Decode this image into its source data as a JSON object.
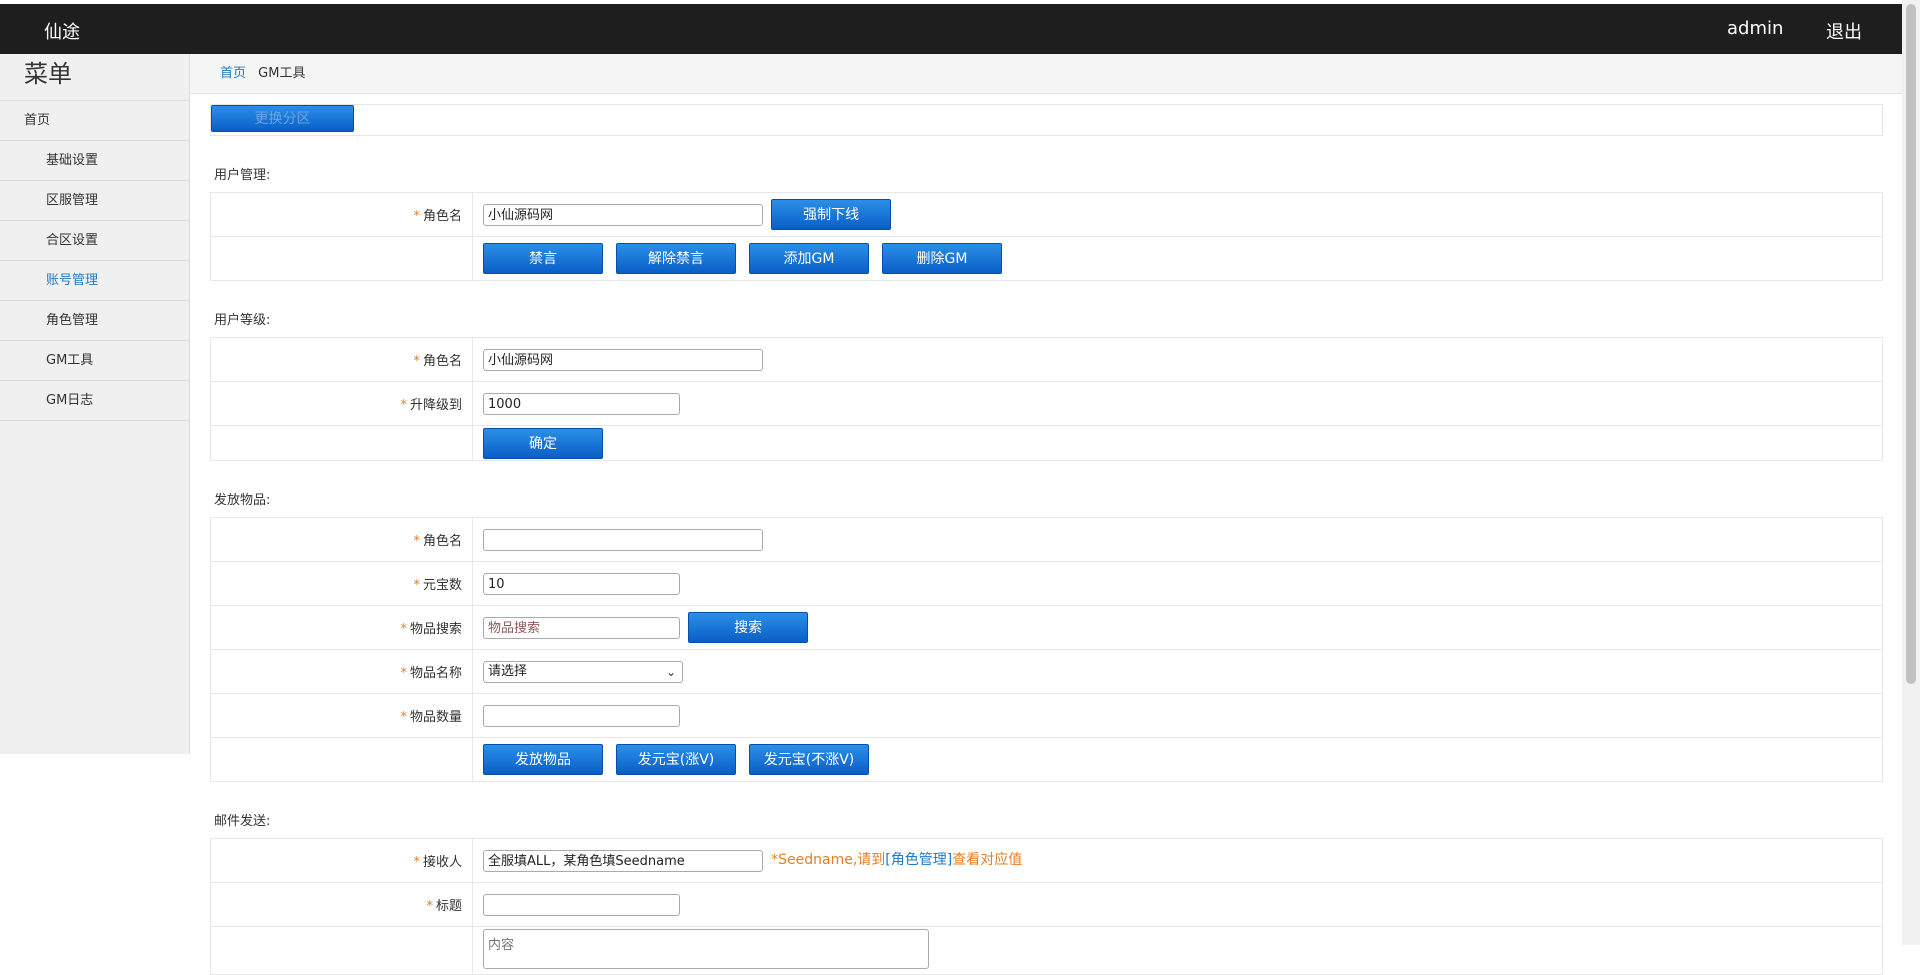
{
  "topbar": {
    "brand": "仙途",
    "user": "admin",
    "logout": "退出"
  },
  "sidebar": {
    "title": "菜单",
    "items": [
      {
        "label": "首页"
      },
      {
        "label": "基础设置"
      },
      {
        "label": "区服管理"
      },
      {
        "label": "合区设置"
      },
      {
        "label": "账号管理"
      },
      {
        "label": "角色管理"
      },
      {
        "label": "GM工具"
      },
      {
        "label": "GM日志"
      }
    ]
  },
  "breadcrumb": {
    "home": "首页",
    "current": "GM工具"
  },
  "zone_button": "更换分区",
  "user_manage": {
    "title": "用户管理:",
    "role_label": "角色名",
    "role_value": "小仙源码网",
    "kick_button": "强制下线",
    "mute_button": "禁言",
    "unmute_button": "解除禁言",
    "add_gm_button": "添加GM",
    "del_gm_button": "删除GM"
  },
  "user_level": {
    "title": "用户等级:",
    "role_label": "角色名",
    "role_value": "小仙源码网",
    "level_label": "升降级到",
    "level_value": "1000",
    "confirm_button": "确定"
  },
  "items": {
    "title": "发放物品:",
    "role_label": "角色名",
    "role_value": "",
    "yuanbao_label": "元宝数",
    "yuanbao_value": "10",
    "search_label": "物品搜索",
    "search_placeholder": "物品搜索",
    "search_button": "搜索",
    "name_label": "物品名称",
    "name_selected": "请选择",
    "qty_label": "物品数量",
    "qty_value": "",
    "send_item_button": "发放物品",
    "send_yb_v_button": "发元宝(涨V)",
    "send_yb_nov_button": "发元宝(不涨V)"
  },
  "mail": {
    "title": "邮件发送:",
    "recipient_label": "接收人",
    "recipient_value": "全服填ALL，某角色填Seedname",
    "hint_prefix": "*Seedname,请到",
    "hint_link": "[角色管理]",
    "hint_suffix": "查看对应值",
    "subject_label": "标题",
    "subject_value": "",
    "content_placeholder": "内容"
  }
}
